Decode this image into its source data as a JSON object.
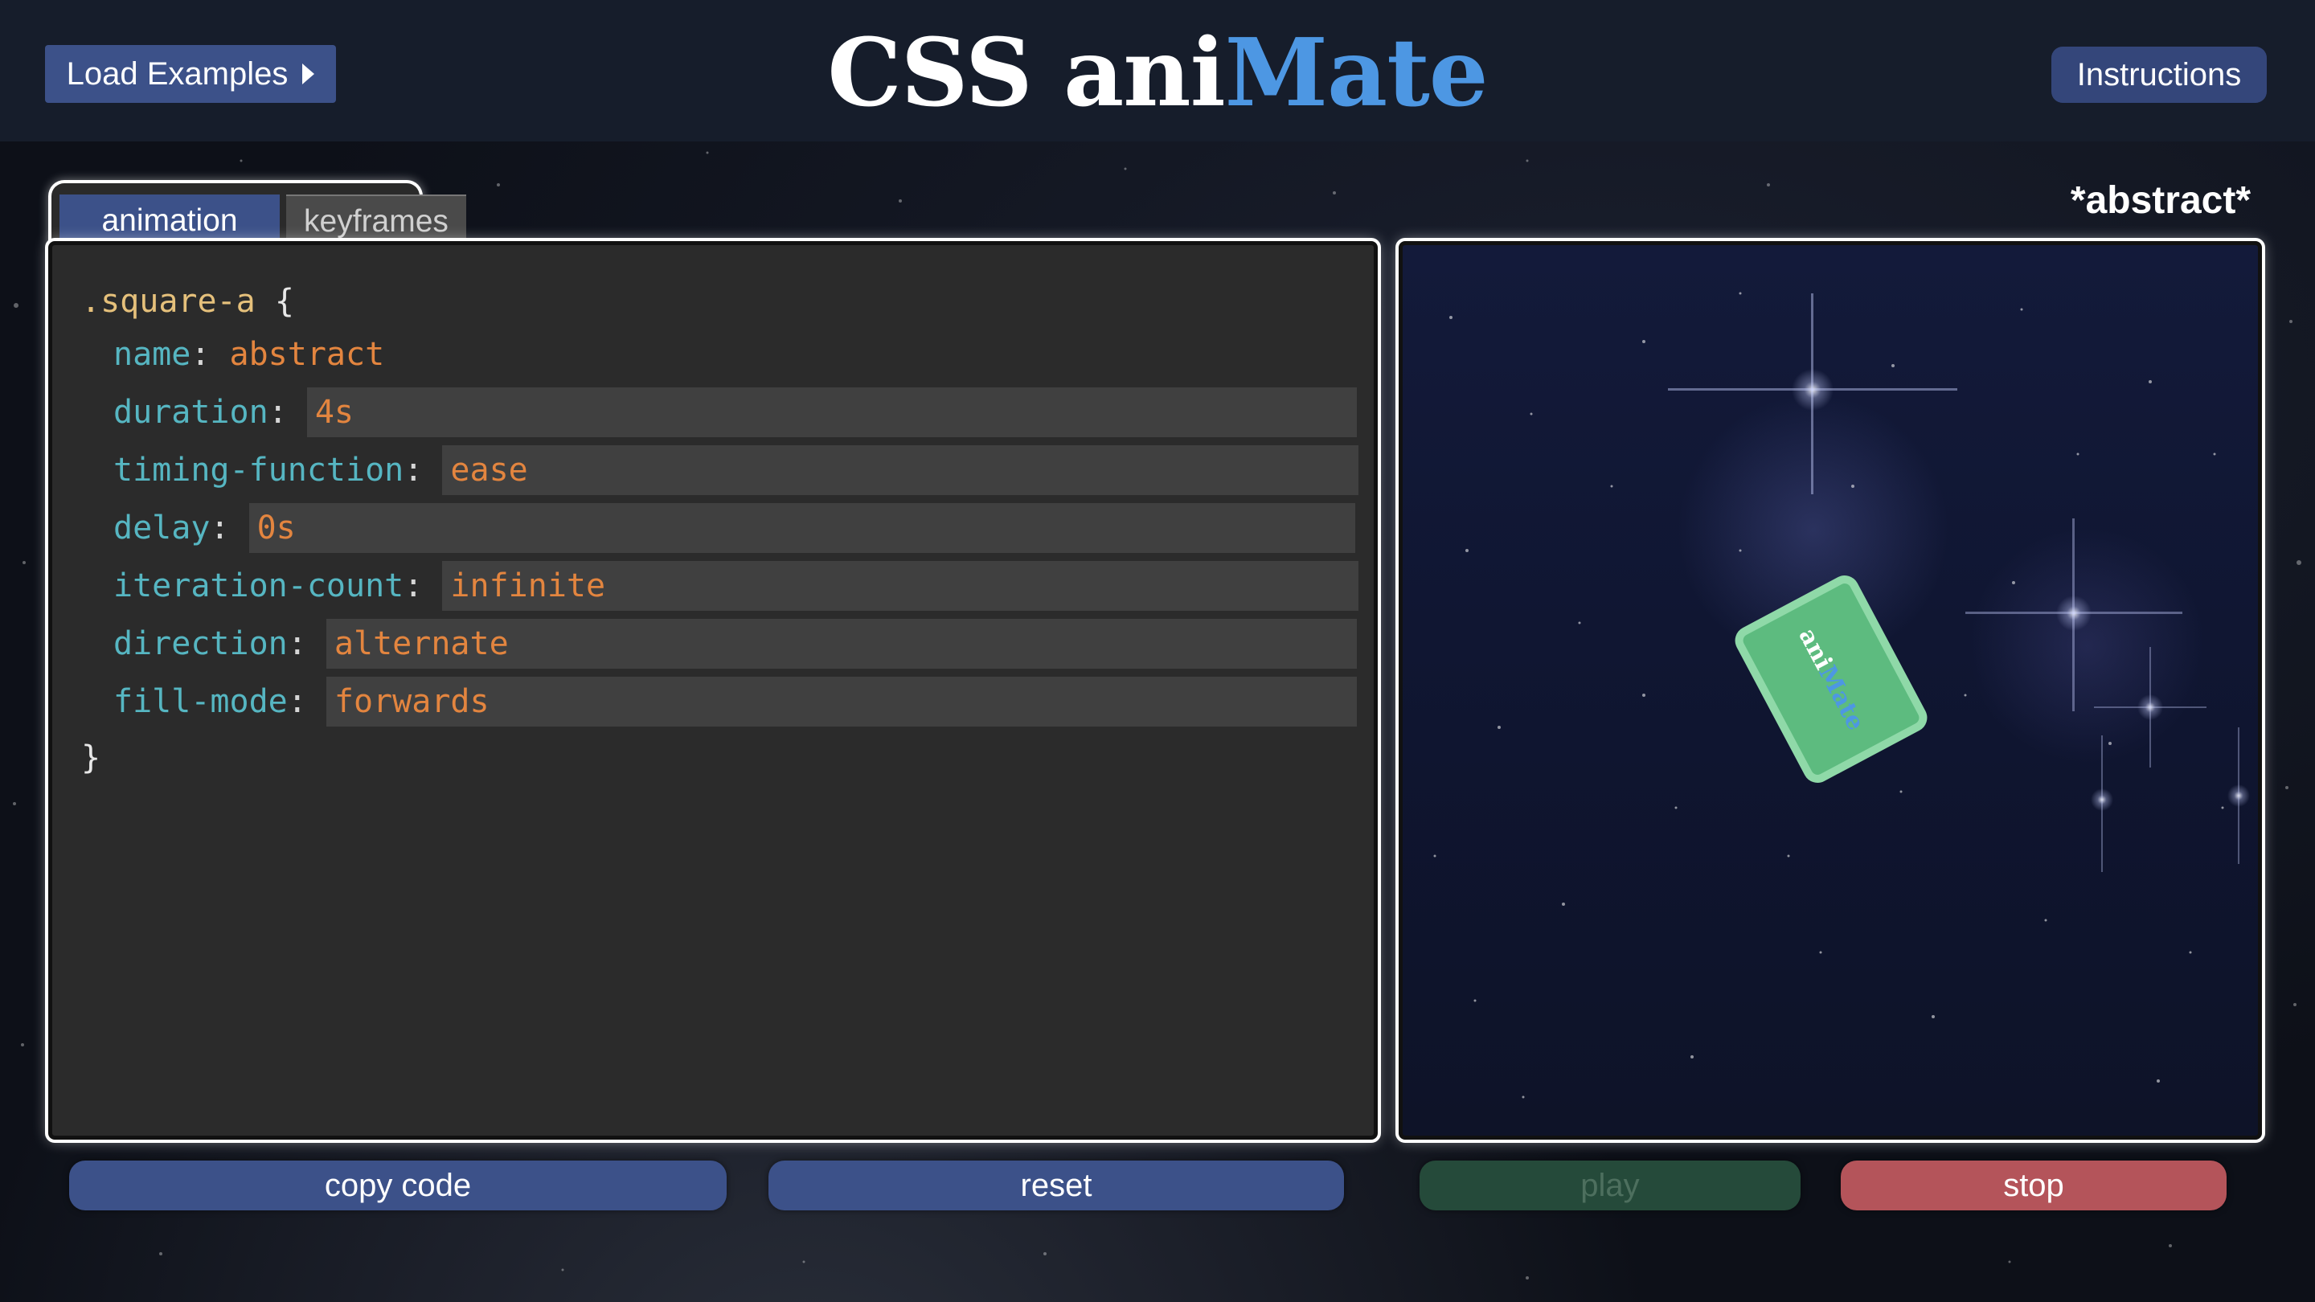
{
  "header": {
    "load_examples_label": "Load Examples",
    "title_part1": "CSS ani",
    "title_part2": "Mate",
    "instructions_label": "Instructions"
  },
  "editor": {
    "tabs": [
      {
        "label": "animation",
        "active": true
      },
      {
        "label": "keyframes",
        "active": false
      }
    ],
    "selector": ".square-a",
    "open_brace": "{",
    "close_brace": "}",
    "properties": [
      {
        "name": "name",
        "value": "abstract",
        "editable": false
      },
      {
        "name": "duration",
        "value": "4s",
        "editable": true
      },
      {
        "name": "timing-function",
        "value": "ease",
        "editable": true
      },
      {
        "name": "delay",
        "value": "0s",
        "editable": true
      },
      {
        "name": "iteration-count",
        "value": "infinite",
        "editable": true
      },
      {
        "name": "direction",
        "value": "alternate",
        "editable": true
      },
      {
        "name": "fill-mode",
        "value": "forwards",
        "editable": true
      }
    ]
  },
  "preview": {
    "label": "*abstract*",
    "square_text_part1": "ani",
    "square_text_part2": "Mate"
  },
  "buttons": {
    "copy": "copy code",
    "reset": "reset",
    "play": "play",
    "stop": "stop"
  },
  "colors": {
    "accent_blue": "#4d97e3",
    "button_blue": "#3c5189",
    "square_green": "#5dbb7f",
    "stop_red": "#b4545a",
    "play_disabled_green": "#254a3a",
    "selector_yellow": "#e5c07b",
    "property_cyan": "#56b6c2",
    "value_orange": "#e3853f"
  }
}
